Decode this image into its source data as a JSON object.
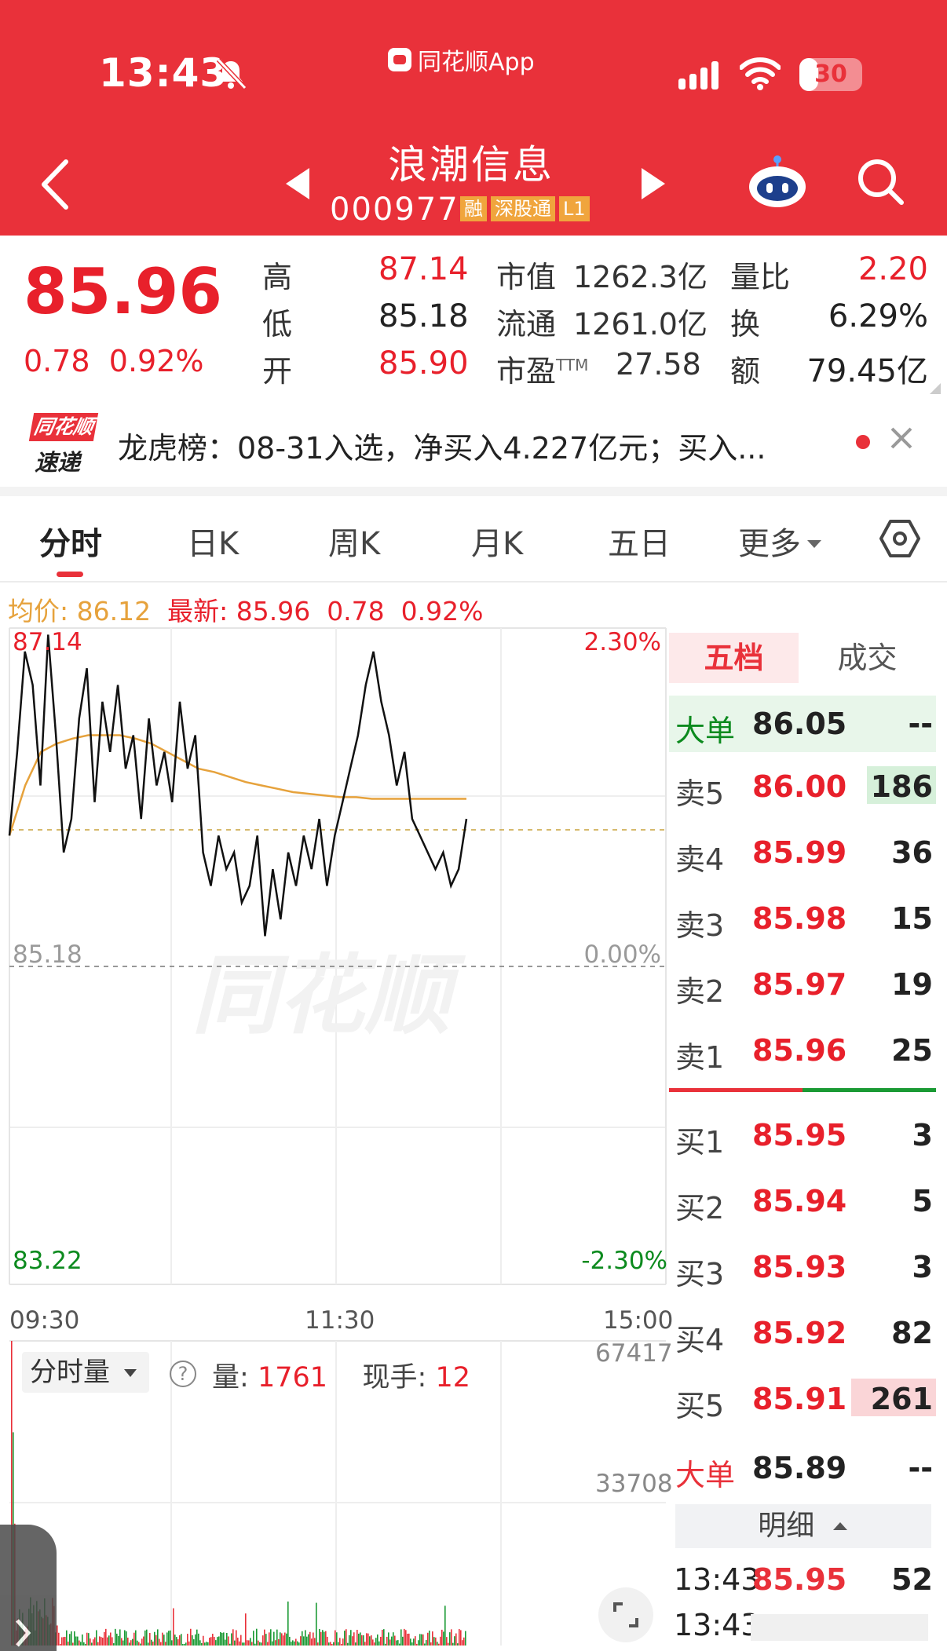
{
  "status_bar": {
    "time": "13:43",
    "source_app": "同花顺App",
    "battery": "30"
  },
  "stock": {
    "name": "浪潮信息",
    "code": "000977",
    "tags": [
      "融",
      "深股通",
      "L1"
    ]
  },
  "quote": {
    "price": "85.96",
    "change": "0.78",
    "change_pct": "0.92%",
    "high_label": "高",
    "high": "87.14",
    "low_label": "低",
    "low": "85.18",
    "open_label": "开",
    "open": "85.90",
    "mktcap_label": "市值",
    "mktcap": "1262.3亿",
    "float_label": "流通",
    "float": "1261.0亿",
    "pe_label": "市盈",
    "pe_sup": "TTM",
    "pe": "27.58",
    "vol_ratio_label": "量比",
    "vol_ratio": "2.20",
    "turnover_label": "换",
    "turnover": "6.29%",
    "amount_label": "额",
    "amount": "79.45亿"
  },
  "news": {
    "logo_top": "同花顺",
    "logo_bottom": "速递",
    "text": "龙虎榜：08-31入选，净买入4.227亿元；买入..."
  },
  "tabs": [
    "分时",
    "日K",
    "周K",
    "月K",
    "五日",
    "更多"
  ],
  "active_tab": 0,
  "avg_line": {
    "avg_label": "均价:",
    "avg": "86.12",
    "latest_label": "最新:",
    "latest": "85.96",
    "chg": "0.78",
    "pct": "0.92%"
  },
  "chart_axes": {
    "y_top": "87.14",
    "y_mid": "85.18",
    "y_bottom": "83.22",
    "pct_top": "2.30%",
    "pct_mid": "0.00%",
    "pct_bottom": "-2.30%",
    "x_labels": [
      "09:30",
      "11:30",
      "15:00"
    ],
    "vol_max": "67417",
    "vol_mid": "33708"
  },
  "volume_panel": {
    "selector": "分时量",
    "vol_label": "量:",
    "vol": "1761",
    "hand_label": "现手:",
    "hand": "12"
  },
  "order_book": {
    "tabs": [
      "五档",
      "成交"
    ],
    "big_sell": {
      "label": "大单",
      "price": "86.05",
      "vol": "--"
    },
    "asks": [
      {
        "label": "卖5",
        "price": "86.00",
        "vol": "186"
      },
      {
        "label": "卖4",
        "price": "85.99",
        "vol": "36"
      },
      {
        "label": "卖3",
        "price": "85.98",
        "vol": "15"
      },
      {
        "label": "卖2",
        "price": "85.97",
        "vol": "19"
      },
      {
        "label": "卖1",
        "price": "85.96",
        "vol": "25"
      }
    ],
    "bids": [
      {
        "label": "买1",
        "price": "85.95",
        "vol": "3"
      },
      {
        "label": "买2",
        "price": "85.94",
        "vol": "5"
      },
      {
        "label": "买3",
        "price": "85.93",
        "vol": "3"
      },
      {
        "label": "买4",
        "price": "85.92",
        "vol": "82"
      },
      {
        "label": "买5",
        "price": "85.91",
        "vol": "261"
      }
    ],
    "big_buy": {
      "label": "大单",
      "price": "85.89",
      "vol": "--"
    },
    "detail_label": "明细",
    "ticks": [
      {
        "time": "13:43",
        "price": "85.95",
        "vol": "52"
      },
      {
        "time": "13:43",
        "price": "",
        "vol": ""
      }
    ]
  },
  "watermark": "同花顺",
  "chart_data": {
    "type": "line",
    "title": "",
    "x_range": [
      "09:30",
      "15:00"
    ],
    "ylim": [
      83.22,
      87.14
    ],
    "prev_close": 85.18,
    "series": [
      {
        "name": "",
        "values": [
          85.9,
          86.4,
          87.0,
          86.8,
          86.2,
          87.1,
          86.5,
          85.8,
          86.0,
          86.6,
          86.9,
          86.1,
          86.7,
          86.4,
          86.8,
          86.3,
          86.5,
          86.0,
          86.6,
          86.2,
          86.4,
          86.1,
          86.7,
          86.3,
          86.5,
          85.8,
          85.6,
          85.9,
          85.7,
          85.8,
          85.5,
          85.6,
          85.9,
          85.3,
          85.7,
          85.4,
          85.8,
          85.6,
          85.9,
          85.7,
          86.0,
          85.6,
          85.9,
          86.1,
          86.3,
          86.5,
          86.8,
          87.0,
          86.7,
          86.5,
          86.2,
          86.4,
          86.0,
          85.9,
          85.8,
          85.7,
          85.8,
          85.6,
          85.7,
          86.0
        ]
      },
      {
        "name": "",
        "values": [
          85.9,
          86.2,
          86.4,
          86.45,
          86.48,
          86.5,
          86.5,
          86.5,
          86.48,
          86.45,
          86.4,
          86.35,
          86.3,
          86.28,
          86.25,
          86.22,
          86.2,
          86.18,
          86.16,
          86.15,
          86.14,
          86.13,
          86.13,
          86.12,
          86.12,
          86.12,
          86.12,
          86.12,
          86.12,
          86.12
        ]
      }
    ],
    "volume_max": 67417
  }
}
